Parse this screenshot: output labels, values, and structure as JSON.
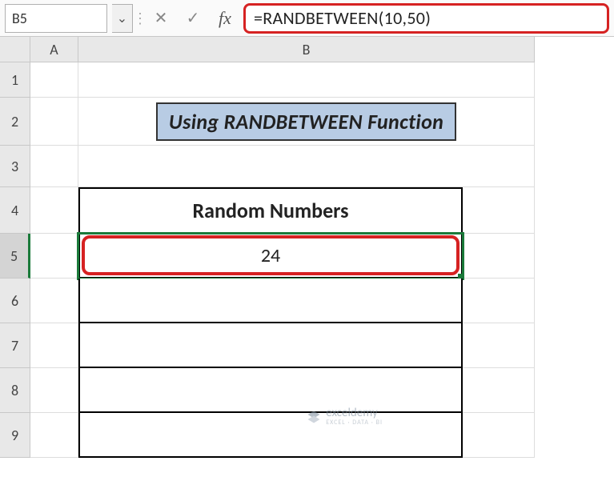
{
  "nameBox": {
    "value": "B5"
  },
  "formulaBar": {
    "value": "=RANDBETWEEN(10,50)"
  },
  "columns": {
    "A": "A",
    "B": "B"
  },
  "rows": [
    "1",
    "2",
    "3",
    "4",
    "5",
    "6",
    "7",
    "8",
    "9"
  ],
  "title": "Using RANDBETWEEN Function",
  "table": {
    "header": "Random Numbers",
    "values": [
      "24",
      "",
      "",
      "",
      ""
    ]
  },
  "watermark": {
    "brand": "exceldemy",
    "tagline": "EXCEL · DATA · BI"
  },
  "icons": {
    "chevronDown": "⌄",
    "cancel": "✕",
    "confirm": "✓",
    "fx": "fx",
    "divider": "⋮"
  }
}
